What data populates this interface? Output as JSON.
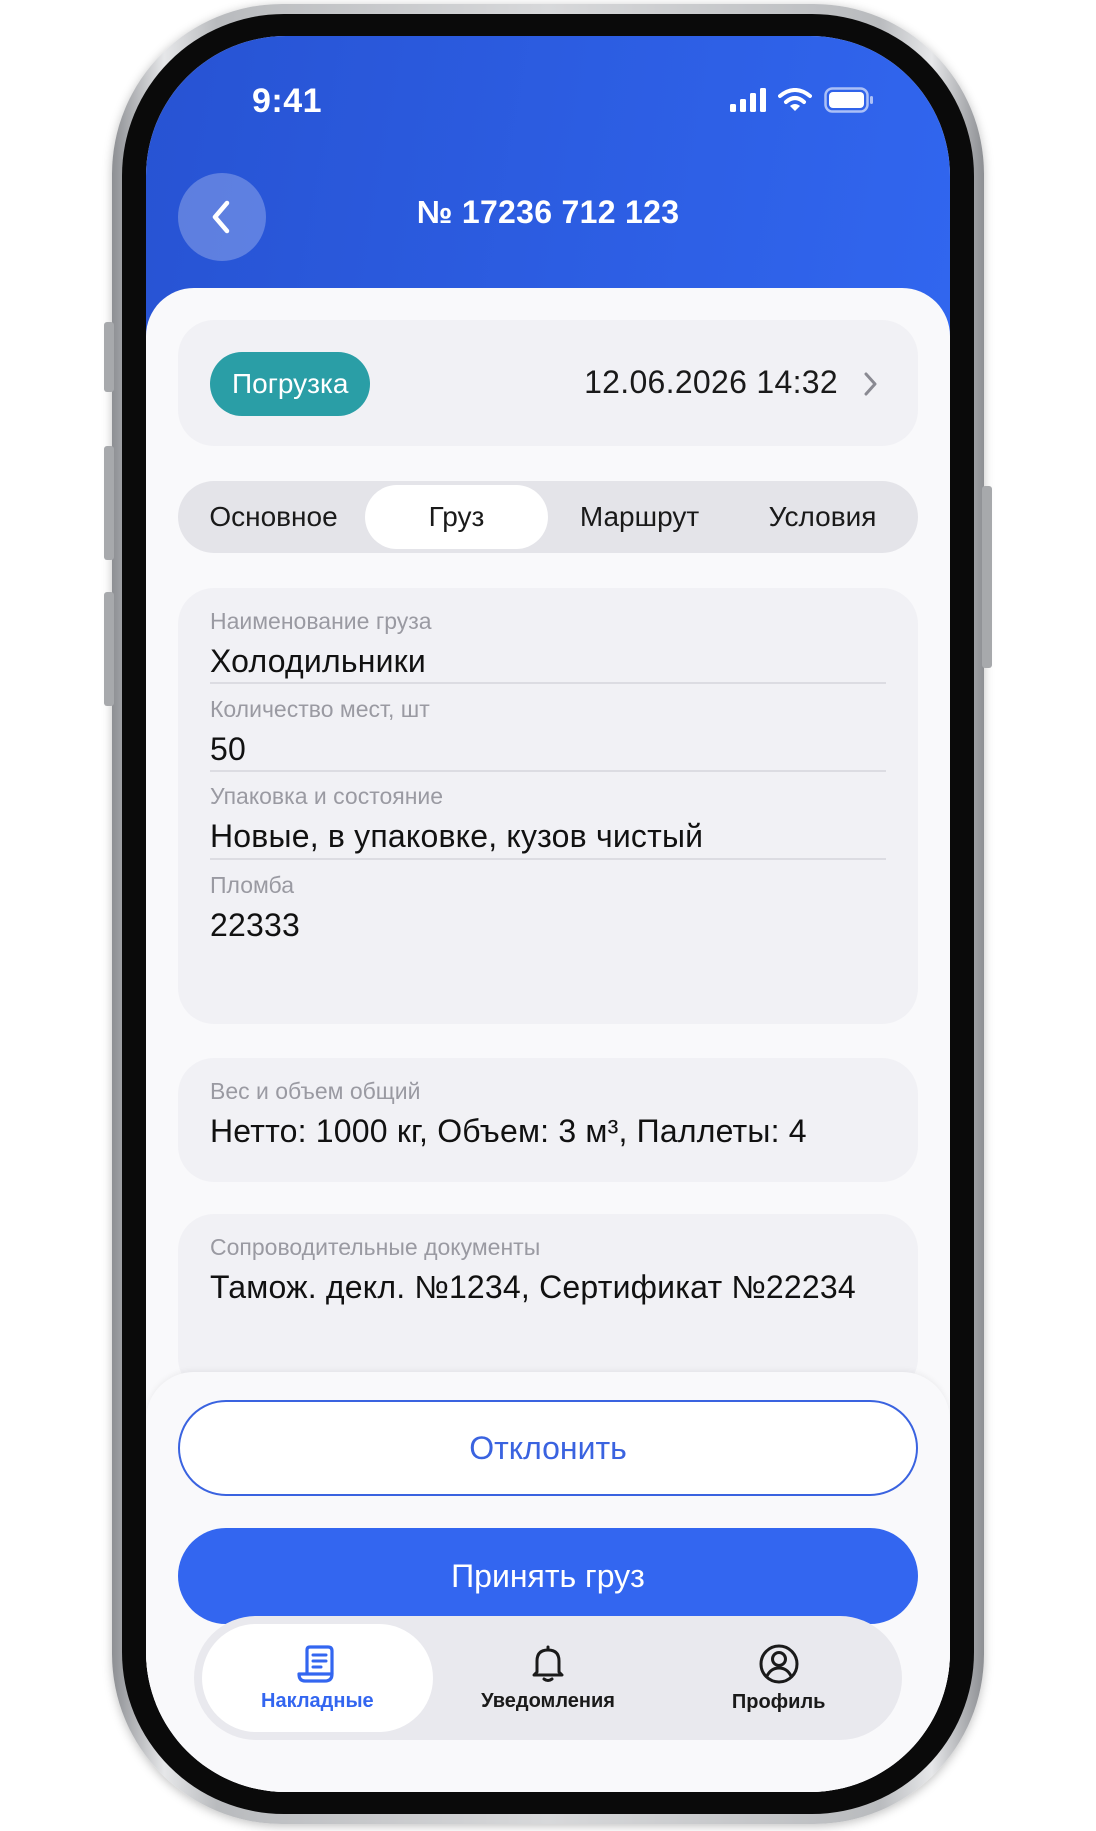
{
  "status_bar": {
    "time": "9:41"
  },
  "header": {
    "title": "№ 17236 712 123"
  },
  "status_card": {
    "badge": "Погрузка",
    "datetime": "12.06.2026 14:32"
  },
  "tabs": [
    {
      "label": "Основное",
      "active": false
    },
    {
      "label": "Груз",
      "active": true
    },
    {
      "label": "Маршрут",
      "active": false
    },
    {
      "label": "Условия",
      "active": false
    }
  ],
  "cargo": {
    "fields": [
      {
        "label": "Наименование груза",
        "value": "Холодильники"
      },
      {
        "label": "Количество мест, шт",
        "value": "50"
      },
      {
        "label": "Упаковка и состояние",
        "value": "Новые, в упаковке, кузов чистый"
      },
      {
        "label": "Пломба",
        "value": "22333"
      }
    ],
    "weight": {
      "label": "Вес и объем общий",
      "value": "Нетто: 1000 кг, Объем: 3 м³, Паллеты: 4"
    },
    "documents": {
      "label": "Сопроводительные документы",
      "value": "Тамож. декл. №1234, Сертификат №22234"
    }
  },
  "actions": {
    "reject_label": "Отклонить",
    "accept_label": "Принять груз"
  },
  "bottom_nav": [
    {
      "label": "Накладные",
      "icon": "document-icon",
      "active": true
    },
    {
      "label": "Уведомления",
      "icon": "bell-icon",
      "active": false
    },
    {
      "label": "Профиль",
      "icon": "user-circle-icon",
      "active": false
    }
  ],
  "colors": {
    "header_blue": "#3166ef",
    "badge_teal": "#2a9ea6",
    "accent": "#3366f0"
  }
}
